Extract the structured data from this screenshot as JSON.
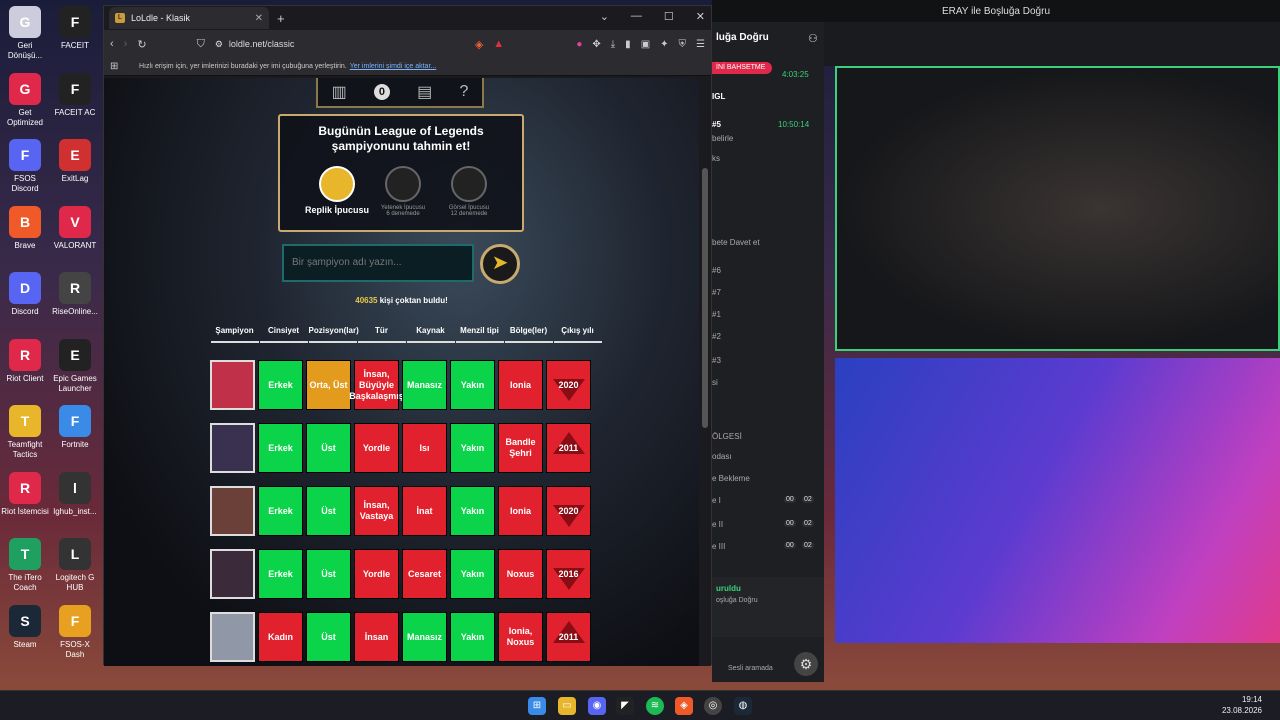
{
  "desktop": {
    "icons_col1": [
      "Geri Dönüşü...",
      "Get Optimized",
      "FSOS Discord",
      "Brave",
      "Discord",
      "Riot Client",
      "Teamfight Tactics",
      "Riot İstemcisi",
      "The iTero Coach",
      "Steam"
    ],
    "icons_col2": [
      "FACEIT",
      "FACEIT AC",
      "ExitLag",
      "VALORANT",
      "RiseOnline...",
      "Epic Games Launcher",
      "Fortnite",
      "lghub_inst...",
      "Logitech G HUB",
      "FSOS-X Dash"
    ]
  },
  "browser": {
    "tab_title": "LoLdle - Klasik",
    "url": "loldle.net/classic",
    "bookmarks_text": "Hızlı erişim için, yer imlerinizi buradaki yer imi çubuğuna yerleştirin.",
    "bookmarks_link": "Yer imlerini şimdi içe aktar..."
  },
  "game": {
    "streak_count": "0",
    "prompt": "Bugünün League of Legends şampiyonunu tahmin et!",
    "hints": [
      {
        "label": "Replik İpucusu",
        "sub": ""
      },
      {
        "label": "Yetenek İpucusu",
        "sub": "6 denemede"
      },
      {
        "label": "Görsel İpucusu",
        "sub": "12 denemede"
      }
    ],
    "search_placeholder": "Bir şampiyon adı yazın...",
    "found_count": "40635",
    "found_text": "kişi çoktan buldu!",
    "headers": [
      "Şampiyon",
      "Cinsiyet",
      "Pozisyon(lar)",
      "Tür",
      "Kaynak",
      "Menzil tipi",
      "Bölge(ler)",
      "Çıkış yılı"
    ],
    "rows": [
      {
        "cells": [
          "Erkek",
          "Orta, Üst",
          "İnsan, Büyüyle Başkalaşmış",
          "Manasız",
          "Yakın",
          "Ionia",
          "2020"
        ],
        "colors": [
          "g",
          "o",
          "r",
          "g",
          "g",
          "r",
          "r"
        ],
        "arrow": "down"
      },
      {
        "cells": [
          "Erkek",
          "Üst",
          "Yordle",
          "Isı",
          "Yakın",
          "Bandle Şehri",
          "2011"
        ],
        "colors": [
          "g",
          "g",
          "r",
          "r",
          "g",
          "r",
          "r"
        ],
        "arrow": "up"
      },
      {
        "cells": [
          "Erkek",
          "Üst",
          "İnsan, Vastaya",
          "İnat",
          "Yakın",
          "Ionia",
          "2020"
        ],
        "colors": [
          "g",
          "g",
          "r",
          "r",
          "g",
          "r",
          "r"
        ],
        "arrow": "down"
      },
      {
        "cells": [
          "Erkek",
          "Üst",
          "Yordle",
          "Cesaret",
          "Yakın",
          "Noxus",
          "2016"
        ],
        "colors": [
          "g",
          "g",
          "r",
          "r",
          "g",
          "r",
          "r"
        ],
        "arrow": "down"
      },
      {
        "cells": [
          "Kadın",
          "Üst",
          "İnsan",
          "Manasız",
          "Yakın",
          "Ionia, Noxus",
          "2011"
        ],
        "colors": [
          "r",
          "g",
          "r",
          "g",
          "g",
          "r",
          "r"
        ],
        "arrow": "up"
      }
    ]
  },
  "stream": {
    "title": "ERAY ile Boşluğa Doğru",
    "channel_header": "luğa Doğru",
    "times": [
      "4:03:25",
      "10:50:14"
    ],
    "banner": "İNİ BAHSETME",
    "left_items": [
      "IGL",
      "#5",
      "belirle",
      "ks",
      "bete Davet et",
      "#6",
      "#7",
      "#1",
      "#2",
      "#3",
      "si",
      "ÖLGESİ",
      "odası",
      "e Bekleme",
      "e I",
      "e II",
      "e III"
    ],
    "voice_status": "uruldu",
    "voice_sub": "oşluğa Doğru",
    "voice_call": "Sesli aramada",
    "counters": [
      "00",
      "02",
      "00",
      "02",
      "00",
      "02"
    ]
  },
  "taskbar": {
    "time": "19:14",
    "date": "23.08.2026"
  }
}
